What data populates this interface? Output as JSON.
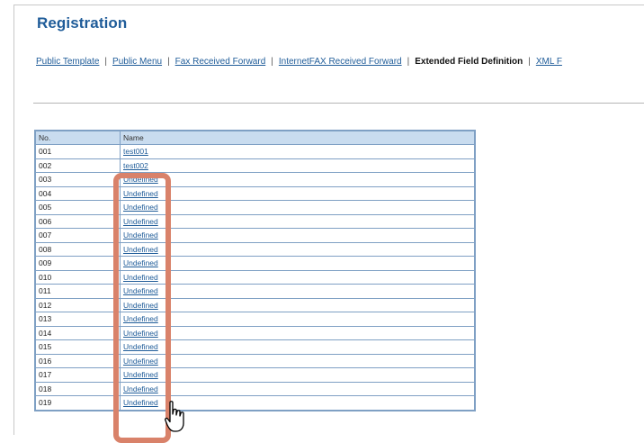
{
  "page": {
    "title": "Registration"
  },
  "nav": {
    "items": [
      {
        "label": "Public Template",
        "link": true
      },
      {
        "label": "Public Menu",
        "link": true
      },
      {
        "label": "Fax Received Forward",
        "link": true
      },
      {
        "label": "InternetFAX Received Forward",
        "link": true
      },
      {
        "label": "Extended Field Definition",
        "link": false
      },
      {
        "label": "XML F",
        "link": true
      }
    ],
    "separator": "|"
  },
  "table": {
    "headers": {
      "no": "No.",
      "name": "Name"
    },
    "rows": [
      {
        "no": "001",
        "name": "test001"
      },
      {
        "no": "002",
        "name": "test002"
      },
      {
        "no": "003",
        "name": "Undefined"
      },
      {
        "no": "004",
        "name": "Undefined"
      },
      {
        "no": "005",
        "name": "Undefined"
      },
      {
        "no": "006",
        "name": "Undefined"
      },
      {
        "no": "007",
        "name": "Undefined"
      },
      {
        "no": "008",
        "name": "Undefined"
      },
      {
        "no": "009",
        "name": "Undefined"
      },
      {
        "no": "010",
        "name": "Undefined"
      },
      {
        "no": "011",
        "name": "Undefined"
      },
      {
        "no": "012",
        "name": "Undefined"
      },
      {
        "no": "013",
        "name": "Undefined"
      },
      {
        "no": "014",
        "name": "Undefined"
      },
      {
        "no": "015",
        "name": "Undefined"
      },
      {
        "no": "016",
        "name": "Undefined"
      },
      {
        "no": "017",
        "name": "Undefined"
      },
      {
        "no": "018",
        "name": "Undefined"
      },
      {
        "no": "019",
        "name": "Undefined"
      }
    ]
  },
  "colors": {
    "link": "#1f5c99",
    "header_bg": "#c9dcef",
    "table_border": "#7fa0c4",
    "highlight": "#d9826a"
  },
  "icons": {
    "cursor": "hand-pointer-icon"
  }
}
